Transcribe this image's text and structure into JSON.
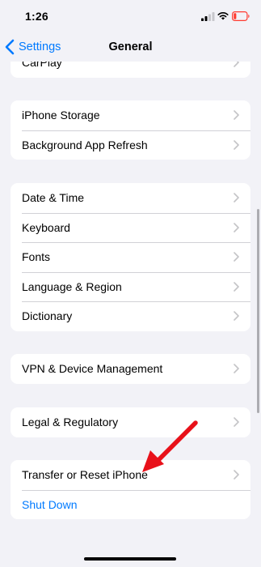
{
  "status": {
    "time": "1:26",
    "icons": [
      "signal-icon",
      "wifi-icon",
      "battery-low-icon"
    ],
    "battery_color": "#ff3b30"
  },
  "nav": {
    "back_label": "Settings",
    "title": "General"
  },
  "groups": [
    {
      "rows": [
        {
          "label": "CarPlay"
        }
      ]
    },
    {
      "rows": [
        {
          "label": "iPhone Storage"
        },
        {
          "label": "Background App Refresh"
        }
      ]
    },
    {
      "rows": [
        {
          "label": "Date & Time"
        },
        {
          "label": "Keyboard"
        },
        {
          "label": "Fonts"
        },
        {
          "label": "Language & Region"
        },
        {
          "label": "Dictionary"
        }
      ]
    },
    {
      "rows": [
        {
          "label": "VPN & Device Management"
        }
      ]
    },
    {
      "rows": [
        {
          "label": "Legal & Regulatory"
        }
      ]
    },
    {
      "rows": [
        {
          "label": "Transfer or Reset iPhone"
        },
        {
          "label": "Shut Down"
        }
      ]
    }
  ],
  "colors": {
    "accent": "#007aff",
    "background": "#f2f2f7",
    "annotation_arrow": "#e8111a"
  }
}
